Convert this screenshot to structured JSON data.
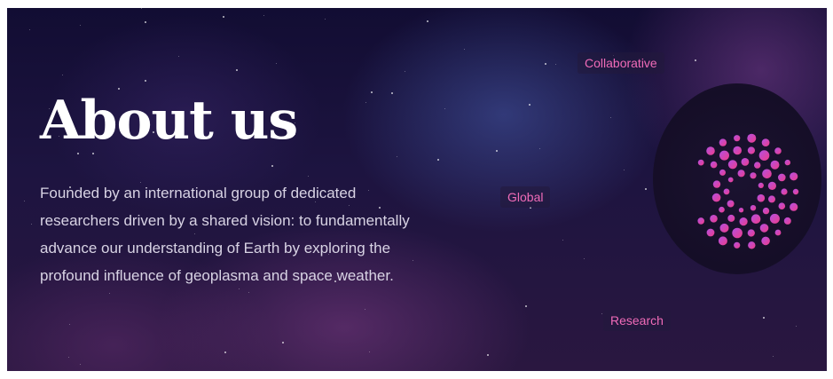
{
  "hero": {
    "title": "About us",
    "description": "Founded by an international group of dedicated researchers driven by a shared vision: to fundamentally advance our understanding of Earth by exploring the profound influence of geoplasma and space weather."
  },
  "tags": {
    "collaborative": "Collaborative",
    "global": "Global",
    "research": "Research"
  },
  "logo": {
    "icon": "dot-ring-logo-icon",
    "gradient_start": "#b24fe3",
    "gradient_end": "#ef3d8a"
  },
  "colors": {
    "background": "#1a1238",
    "title": "#ffffff",
    "body_text": "#d8d3e4",
    "tag_text": "#f06bb8"
  }
}
